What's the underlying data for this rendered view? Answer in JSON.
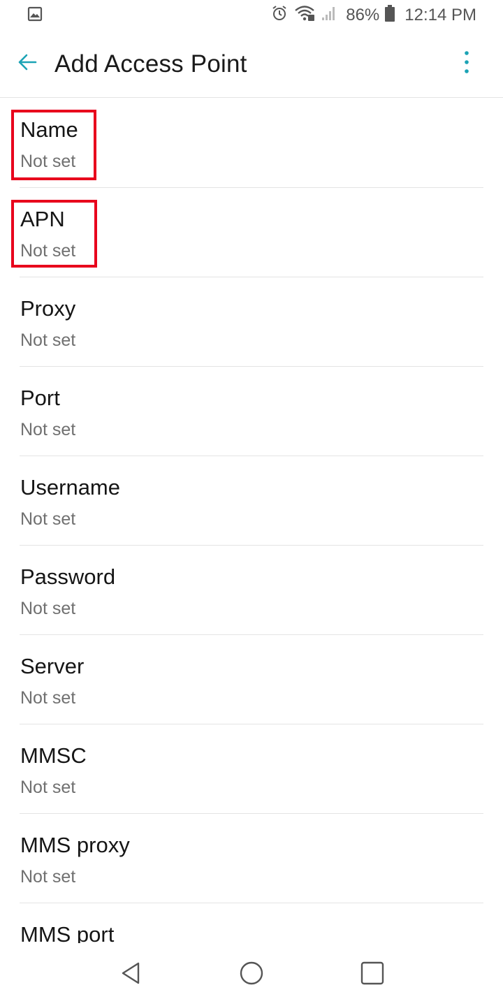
{
  "status_bar": {
    "battery": "86%",
    "time": "12:14 PM",
    "icons": [
      "image-icon",
      "alarm-icon",
      "wifi-icon",
      "signal-icon",
      "battery-icon"
    ]
  },
  "app_bar": {
    "title": "Add Access Point",
    "accent_color": "#1ba3b5"
  },
  "list": {
    "items": [
      {
        "title": "Name",
        "value": "Not set"
      },
      {
        "title": "APN",
        "value": "Not set"
      },
      {
        "title": "Proxy",
        "value": "Not set"
      },
      {
        "title": "Port",
        "value": "Not set"
      },
      {
        "title": "Username",
        "value": "Not set"
      },
      {
        "title": "Password",
        "value": "Not set"
      },
      {
        "title": "Server",
        "value": "Not set"
      },
      {
        "title": "MMSC",
        "value": "Not set"
      },
      {
        "title": "MMS proxy",
        "value": "Not set"
      },
      {
        "title": "MMS port",
        "value": ""
      }
    ],
    "highlight_color": "#e8001c"
  },
  "nav_bar": {
    "icons": [
      "back-triangle-icon",
      "home-circle-icon",
      "recents-square-icon"
    ]
  }
}
